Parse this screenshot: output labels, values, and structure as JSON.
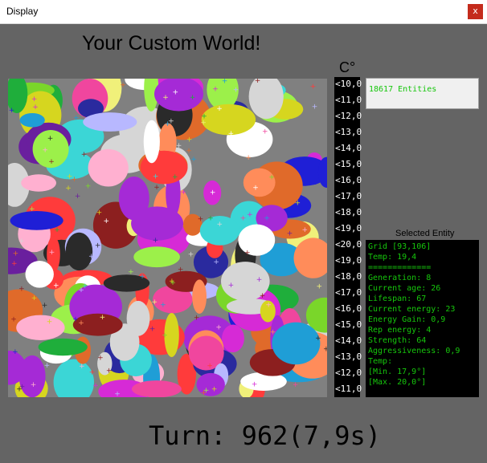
{
  "window": {
    "title": "Display",
    "close_label": "x"
  },
  "heading": "Your Custom World!",
  "temperature_scale": {
    "unit": "C°",
    "ticks": [
      "<10,0",
      "<11,0",
      "<12,0",
      "<13,0",
      "<14,0",
      "<15,0",
      "<16,0",
      "<17,0",
      "<18,0",
      "<19,0",
      "<20,0",
      "<19,0",
      "<18,0",
      "<17,0",
      "<16,0",
      "<15,0",
      "<14,0",
      "<13,0",
      "<12,0",
      "<11,0"
    ]
  },
  "entity_count": "18617 Entities",
  "selected_entity": {
    "label": "Selected Entity",
    "lines": [
      "Grid [93,106]",
      "Temp: 19,4",
      "=============",
      "Generation: 8",
      "Current age: 26",
      "Lifespan: 67",
      "Current energy: 23",
      "Energy Gain: 0,9",
      "Rep energy: 4",
      "Strength: 64",
      "Aggressiveness: 0,9",
      "Temp:",
      "[Min. 17,9°]",
      "[Max. 20,0°]"
    ]
  },
  "turn": "Turn: 962(7,9s)",
  "world_colors": [
    "#3bd6d6",
    "#1f1fd6",
    "#a52ad6",
    "#d62ad6",
    "#f0469e",
    "#ff3b3b",
    "#ffb0d0",
    "#9cf04a",
    "#7ad62a",
    "#1fae3b",
    "#2a2a9e",
    "#d6d61f",
    "#f0f07a",
    "#b8b8ff",
    "#d6d6d6",
    "#e06a2a",
    "#ff8c5a",
    "#6a1f9e",
    "#1f9ed6",
    "#ffffff",
    "#2a2a2a",
    "#8c1f1f"
  ]
}
